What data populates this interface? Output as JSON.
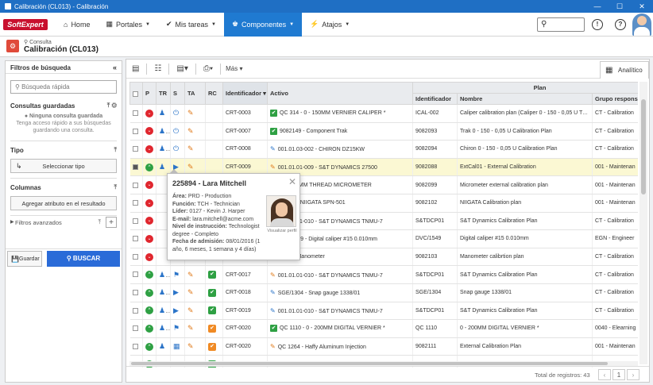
{
  "window": {
    "title": "Calibración (CL013) - Calibración"
  },
  "navbar": {
    "logo": "SoftExpert",
    "items": [
      {
        "label": "Home",
        "icon": "home-icon"
      },
      {
        "label": "Portales",
        "icon": "grid-icon"
      },
      {
        "label": "Mis tareas",
        "icon": "check-icon"
      },
      {
        "label": "Componentes",
        "icon": "trophy-icon",
        "active": true
      },
      {
        "label": "Atajos",
        "icon": "bolt-icon"
      }
    ]
  },
  "page": {
    "subtitle": "Consulta",
    "title": "Calibración (CL013)"
  },
  "sidebar": {
    "header": "Filtros de búsqueda",
    "search_placeholder": "Búsqueda rápida",
    "saved_title": "Consultas guardadas",
    "saved_empty_title": "Ninguna consulta guardada",
    "saved_empty_text": "Tenga acceso rápido a sus búsquedas guardando una consulta.",
    "tipo_title": "Tipo",
    "tipo_button": "Seleccionar tipo",
    "columnas_title": "Columnas",
    "columnas_button": "Agregar atributo en el resultado",
    "advanced": "Filtros avanzados",
    "save_button": "Guardar",
    "search_button": "BUSCAR"
  },
  "toolbar": {
    "more": "Más",
    "analytic_tab": "Analítico"
  },
  "grid": {
    "group_header": "Plan",
    "columns": [
      "P",
      "TR",
      "S",
      "TA",
      "RC",
      "Identificador",
      "Activo",
      "Identificador",
      "Nombre",
      "Grupo respons"
    ],
    "rows": [
      {
        "id": "CRT-0003",
        "asset": "QC 314 - 0 - 150MM VERNIER CALIPER *",
        "asset_icon": "ok",
        "plan_id": "ICAL-002",
        "plan_name": "Caliper calibration plan (Caliper 0 - 150 - 0,05 U Type A)",
        "group": "CT - Calibration",
        "p": "red",
        "tr": "person",
        "s": "power"
      },
      {
        "id": "CRT-0007",
        "asset": "9082149 - Component Trak",
        "asset_icon": "ok",
        "plan_id": "9082093",
        "plan_name": "Trak 0 - 150 - 0,05 U Calibration Plan",
        "group": "CT - Calibration",
        "p": "red",
        "tr": "group",
        "s": "power"
      },
      {
        "id": "CRT-0008",
        "asset": "001.01.03-002 - CHIRON DZ15KW",
        "asset_icon": "tool-blue",
        "plan_id": "9082094",
        "plan_name": "Chiron 0 - 150 - 0,05 U Calibration Plan",
        "group": "CT - Calibration",
        "p": "red",
        "tr": "group",
        "s": "power"
      },
      {
        "id": "CRT-0009",
        "asset": "001.01.01-009 - S&T DYNAMICS 27500",
        "asset_icon": "tool",
        "plan_id": "9082088",
        "plan_name": "ExtCal01 - External Calibration",
        "group": "001 - Maintenan",
        "p": "green",
        "tr": "person",
        "s": "play",
        "selected": true
      },
      {
        "id": "",
        "asset": "099 - 0 - 25MM THREAD MICROMETER",
        "asset_icon": "",
        "plan_id": "9082099",
        "plan_name": "Micrometer external calibration plan",
        "group": "001 - Maintenan",
        "p": "red",
        "tr": "",
        "s": ""
      },
      {
        "id": "",
        "asset": "03.02-022 - NIIGATA SPN-501",
        "asset_icon": "",
        "plan_id": "9082102",
        "plan_name": "NIIGATA Calibration plan",
        "group": "001 - Maintenan",
        "p": "red",
        "tr": "",
        "s": ""
      },
      {
        "id": "",
        "asset": "001.01.01-010 - S&T DYNAMICS TNMU-7",
        "asset_icon": "tool",
        "plan_id": "S&TDCP01",
        "plan_name": "S&T Dynamics Calibration Plan",
        "group": "CT - Calibration",
        "p": "red",
        "tr": "",
        "s": ""
      },
      {
        "id": "",
        "asset": "DVC/1549 - Digital caliper #15 0.010mm",
        "asset_icon": "tool-blue",
        "plan_id": "DVC/1549",
        "plan_name": "Digital caliper #15 0.010mm",
        "group": "EGN - Engineer",
        "p": "red",
        "tr": "",
        "s": ""
      },
      {
        "id": "",
        "asset": "9082174 - Manometer",
        "asset_icon": "",
        "plan_id": "9082103",
        "plan_name": "Manometer calibrtion plan",
        "group": "CT - Calibration",
        "p": "red",
        "tr": "",
        "s": ""
      },
      {
        "id": "CRT-0017",
        "asset": "001.01.01-010 - S&T DYNAMICS TNMU-7",
        "asset_icon": "tool",
        "plan_id": "S&TDCP01",
        "plan_name": "S&T Dynamics Calibration Plan",
        "group": "CT - Calibration",
        "p": "green",
        "tr": "group",
        "s": "flag",
        "rc": "g"
      },
      {
        "id": "CRT-0018",
        "asset": "SGE/1304 - Snap gauge 1338/01",
        "asset_icon": "tool-blue",
        "plan_id": "SGE/1304",
        "plan_name": "Snap gauge 1338/01",
        "group": "CT - Calibration",
        "p": "green",
        "tr": "group",
        "s": "play",
        "rc": "g"
      },
      {
        "id": "CRT-0019",
        "asset": "001.01.01-010 - S&T DYNAMICS TNMU-7",
        "asset_icon": "tool-blue",
        "plan_id": "S&TDCP01",
        "plan_name": "S&T Dynamics Calibration Plan",
        "group": "CT - Calibration",
        "p": "green",
        "tr": "group",
        "s": "play",
        "rc": "g"
      },
      {
        "id": "CRT-0020",
        "asset": "QC 1110 - 0 - 200MM DIGITAL VERNIER *",
        "asset_icon": "ok",
        "plan_id": "QC 1110",
        "plan_name": "0 - 200MM DIGITAL VERNIER *",
        "group": "0040 - Elearning",
        "p": "green",
        "tr": "group",
        "s": "flag",
        "rc": "o"
      },
      {
        "id": "CRT-0020",
        "asset": "QC 1264 - Haffy Aluminum Injection",
        "asset_icon": "tool",
        "plan_id": "9082111",
        "plan_name": "External Calibration Plan",
        "group": "001 - Maintenan",
        "p": "green",
        "tr": "person",
        "s": "calendar",
        "rc": "o"
      },
      {
        "id": "CRT-0021",
        "asset": "021 - Electrical Box",
        "asset_icon": "tool",
        "plan_id": "9082106",
        "plan_name": "Calibration ics",
        "group": "CT - Calibration",
        "p": "green",
        "tr": "group",
        "s": "flag",
        "rc": "g"
      }
    ]
  },
  "popup": {
    "title": "225894 - Lara Mitchell",
    "area_label": "Área:",
    "area": "PRD - Production",
    "funcion_label": "Función:",
    "funcion": "TCH - Technician",
    "lider_label": "Líder:",
    "lider": "0127 - Kevin J. Harper",
    "email_label": "E-mail:",
    "email": "lara.mitchell@acme.com",
    "nivel_label": "Nivel de instrucción:",
    "nivel": "Technologist degree - Completo",
    "fecha_label": "Fecha de admisión:",
    "fecha": "08/01/2016 (1 año, 6 meses, 1 semana y 4 días)",
    "photo_caption": "Visualizar perfil"
  },
  "footer": {
    "total_label": "Total de registros: 43",
    "page": "1"
  },
  "colors": {
    "accent": "#1f7ad1",
    "titlebar": "#1f6fc4",
    "red_status": "#e0262e",
    "green_status": "#2ea043",
    "selected_row": "#fbf8d3"
  }
}
